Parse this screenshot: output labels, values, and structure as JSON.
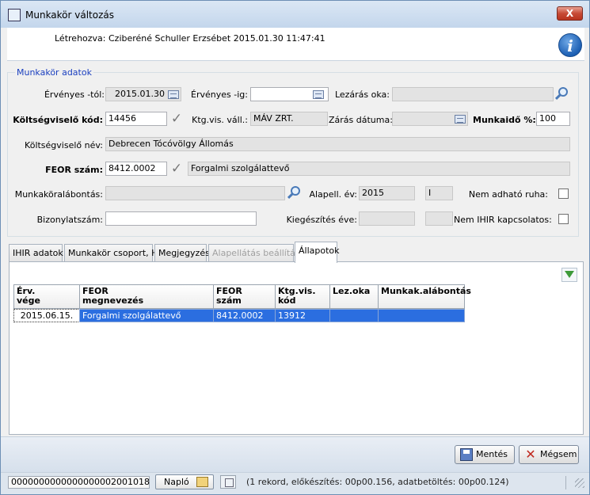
{
  "window": {
    "title": "Munkakör változás",
    "close_glyph": "X"
  },
  "header": {
    "created_by": "Létrehozva: Cziberéné Schuller Erzsébet 2015.01.30 11:47:41",
    "info_glyph": "i"
  },
  "group": {
    "title": "Munkakör adatok"
  },
  "form": {
    "ervenyes_tol_label": "Érvényes -tól:",
    "ervenyes_tol_value": "2015.01.30",
    "ervenyes_ig_label": "Érvényes -ig:",
    "ervenyes_ig_value": "",
    "lezaras_oka_label": "Lezárás oka:",
    "lezaras_oka_value": "",
    "koltseg_kod_label": "Költségviselő kód:",
    "koltseg_kod_value": "14456",
    "ktg_vis_vall_label": "Ktg.vis. váll.:",
    "ktg_vis_vall_value": "MÁV ZRT.",
    "zaras_datuma_label": "Zárás dátuma:",
    "zaras_datuma_value": "",
    "munkaido_label": "Munkaidő %:",
    "munkaido_value": "100",
    "koltseg_nev_label": "Költségviselő név:",
    "koltseg_nev_value": "Debrecen Tócóvölgy Állomás",
    "feor_label": "FEOR szám:",
    "feor_value": "8412.0002",
    "feor_nev_value": "Forgalmi szolgálattevő",
    "munkakoralabontas_label": "Munkaköralábontás:",
    "munkakoralabontas_value": "",
    "alapell_ev_label": "Alapell. év:",
    "alapell_ev_value": "2015",
    "alapell_ev_code": "I",
    "nem_adhato_ruha_label": "Nem adható ruha:",
    "bizonylatszam_label": "Bizonylatszám:",
    "bizonylatszam_value": "",
    "kiegeszites_eve_label": "Kiegészítés éve:",
    "kiegeszites_eve_value": "",
    "kiegeszites_eve_code": "",
    "nem_ihir_label": "Nem IHIR kapcsolatos:"
  },
  "tabs": [
    {
      "label": "IHIR adatok",
      "state": "normal"
    },
    {
      "label": "Munkakör csoport, HF",
      "state": "normal"
    },
    {
      "label": "Megjegyzés",
      "state": "normal"
    },
    {
      "label": "Alapellátás beállítása",
      "state": "disabled"
    },
    {
      "label": "Állapotok",
      "state": "active"
    }
  ],
  "table": {
    "headers": [
      "Érv.\nvége",
      "FEOR\nmegnevezés",
      "FEOR\nszám",
      "Ktg.vis.\nkód",
      "Lez.oka",
      "Munkak.alábontás"
    ],
    "rows": [
      [
        "2015.06.15.",
        "Forgalmi szolgálattevő",
        "8412.0002",
        "13912",
        "",
        ""
      ]
    ]
  },
  "buttons": {
    "save": "Mentés",
    "cancel": "Mégsem"
  },
  "status": {
    "id": "0000000000000000002001018",
    "naplo": "Napló",
    "info": "(1 rekord, előkészítés: 00p00.156, adatbetöltés: 00p00.124)"
  }
}
